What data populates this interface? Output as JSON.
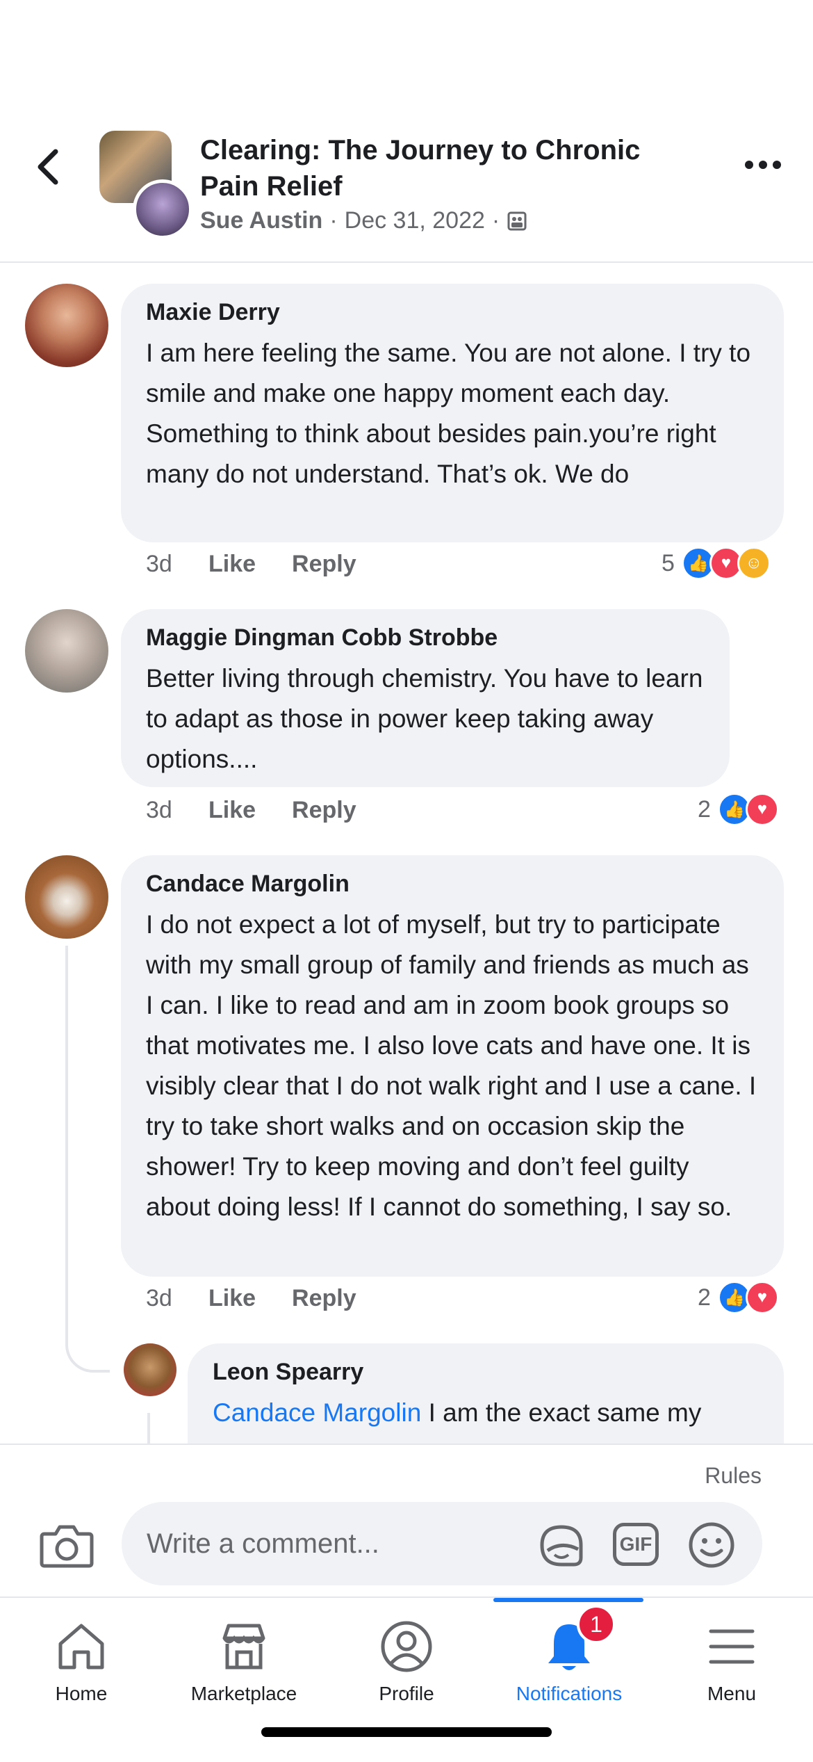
{
  "header": {
    "group_title": "Clearing: The Journey to Chronic Pain Relief",
    "author": "Sue Austin",
    "date": "Dec 31, 2022",
    "separator": "·",
    "back_icon": "chevron-left-icon",
    "more_icon": "more-options-icon",
    "privacy_icon": "group-privacy-icon"
  },
  "comments": [
    {
      "author": "Maxie Derry",
      "text": "I am here feeling the same. You are not alone. I try to smile and make one happy moment each day. Something to think about besides pain.you’re right many do not understand. That’s ok. We do",
      "time": "3d",
      "like_label": "Like",
      "reply_label": "Reply",
      "reaction_count": "5",
      "reactions": [
        "like",
        "love",
        "care"
      ]
    },
    {
      "author": "Maggie Dingman Cobb Strobbe",
      "text": "Better living through chemistry.  You have to learn to adapt as those in power keep taking away options....",
      "time": "3d",
      "like_label": "Like",
      "reply_label": "Reply",
      "reaction_count": "2",
      "reactions": [
        "like",
        "love"
      ]
    },
    {
      "author": "Candace Margolin",
      "text": "I do not expect a lot of myself, but try to participate with my  small group of family and friends as much as I can. I like to read and am in zoom book groups so that motivates me. I also love cats and have one. It is visibly clear that I do not walk right and I use a cane. I try to take short walks and on occasion skip the shower! Try to keep moving and don’t feel guilty about doing less! If I cannot do something, I say so.",
      "time": "3d",
      "like_label": "Like",
      "reply_label": "Reply",
      "reaction_count": "2",
      "reactions": [
        "like",
        "love"
      ]
    },
    {
      "author": "Leon Spearry",
      "mention": "Candace Margolin",
      "text": " I am the exact same my"
    }
  ],
  "composer": {
    "rules_label": "Rules",
    "placeholder": "Write a comment...",
    "gif_label": "GIF",
    "icons": [
      "camera-icon",
      "sticker-icon",
      "gif-icon",
      "emoji-icon"
    ]
  },
  "nav": {
    "items": [
      {
        "label": "Home",
        "icon": "home-icon"
      },
      {
        "label": "Marketplace",
        "icon": "marketplace-icon"
      },
      {
        "label": "Profile",
        "icon": "profile-icon"
      },
      {
        "label": "Notifications",
        "icon": "bell-icon",
        "badge": "1",
        "active": true
      },
      {
        "label": "Menu",
        "icon": "hamburger-menu-icon"
      }
    ]
  },
  "colors": {
    "accent": "#1877f2",
    "bubble": "#f0f2f5",
    "secondary_text": "#65676b",
    "love": "#f33e58",
    "care": "#f7b125",
    "badge": "#e41e3f"
  }
}
